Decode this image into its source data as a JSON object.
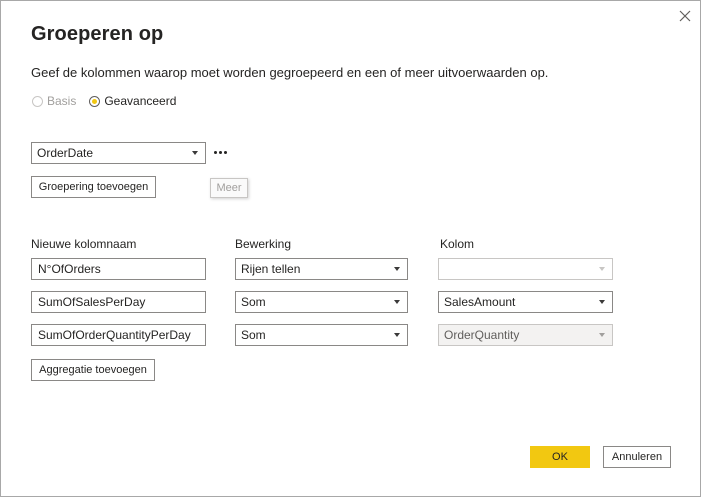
{
  "dialog": {
    "title": "Groeperen op",
    "description": "Geef de kolommen waarop moet worden gegroepeerd en een of meer uitvoerwaarden op.",
    "close_icon": "close-icon"
  },
  "mode": {
    "options": [
      {
        "label": "Basis",
        "selected": false,
        "disabled": true
      },
      {
        "label": "Geavanceerd",
        "selected": true,
        "disabled": false
      }
    ],
    "accent_color": "#f2c811"
  },
  "grouping": {
    "selected_column": "OrderDate",
    "more_icon": "ellipsis-icon",
    "add_button_label": "Groepering toevoegen",
    "more_button_label": "Meer"
  },
  "aggregations": {
    "headers": {
      "new_column_name": "Nieuwe kolomnaam",
      "operation": "Bewerking",
      "column": "Kolom"
    },
    "rows": [
      {
        "name": "N°OfOrders",
        "operation": "Rijen tellen",
        "column": ""
      },
      {
        "name": "SumOfSalesPerDay",
        "operation": "Som",
        "column": "SalesAmount"
      },
      {
        "name": "SumOfOrderQuantityPerDay",
        "operation": "Som",
        "column": "OrderQuantity"
      }
    ],
    "add_button_label": "Aggregatie toevoegen"
  },
  "footer": {
    "ok_label": "OK",
    "cancel_label": "Annuleren"
  }
}
